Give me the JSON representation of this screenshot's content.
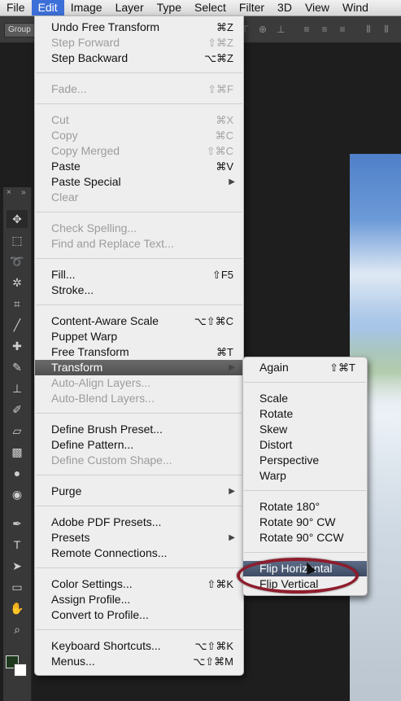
{
  "menubar": {
    "items": [
      "File",
      "Edit",
      "Image",
      "Layer",
      "Type",
      "Select",
      "Filter",
      "3D",
      "View",
      "Wind"
    ],
    "active_index": 1
  },
  "optionsbar": {
    "group_label": "Group"
  },
  "edit_menu": {
    "items": [
      {
        "label": "Undo Free Transform",
        "shortcut": "⌘Z",
        "enabled": true
      },
      {
        "label": "Step Forward",
        "shortcut": "⇧⌘Z",
        "enabled": false
      },
      {
        "label": "Step Backward",
        "shortcut": "⌥⌘Z",
        "enabled": true
      },
      {
        "label": "Fade...",
        "shortcut": "⇧⌘F",
        "enabled": false
      },
      {
        "label": "Cut",
        "shortcut": "⌘X",
        "enabled": false
      },
      {
        "label": "Copy",
        "shortcut": "⌘C",
        "enabled": false
      },
      {
        "label": "Copy Merged",
        "shortcut": "⇧⌘C",
        "enabled": false
      },
      {
        "label": "Paste",
        "shortcut": "⌘V",
        "enabled": true
      },
      {
        "label": "Paste Special",
        "submenu": true,
        "enabled": true
      },
      {
        "label": "Clear",
        "enabled": false
      },
      {
        "label": "Check Spelling...",
        "enabled": false
      },
      {
        "label": "Find and Replace Text...",
        "enabled": false
      },
      {
        "label": "Fill...",
        "shortcut": "⇧F5",
        "enabled": true
      },
      {
        "label": "Stroke...",
        "enabled": true
      },
      {
        "label": "Content-Aware Scale",
        "shortcut": "⌥⇧⌘C",
        "enabled": true
      },
      {
        "label": "Puppet Warp",
        "enabled": true
      },
      {
        "label": "Free Transform",
        "shortcut": "⌘T",
        "enabled": true
      },
      {
        "label": "Transform",
        "submenu": true,
        "enabled": true,
        "highlighted": true
      },
      {
        "label": "Auto-Align Layers...",
        "enabled": false
      },
      {
        "label": "Auto-Blend Layers...",
        "enabled": false
      },
      {
        "label": "Define Brush Preset...",
        "enabled": true
      },
      {
        "label": "Define Pattern...",
        "enabled": true
      },
      {
        "label": "Define Custom Shape...",
        "enabled": false
      },
      {
        "label": "Purge",
        "submenu": true,
        "enabled": true
      },
      {
        "label": "Adobe PDF Presets...",
        "enabled": true
      },
      {
        "label": "Presets",
        "submenu": true,
        "enabled": true
      },
      {
        "label": "Remote Connections...",
        "enabled": true
      },
      {
        "label": "Color Settings...",
        "shortcut": "⇧⌘K",
        "enabled": true
      },
      {
        "label": "Assign Profile...",
        "enabled": true
      },
      {
        "label": "Convert to Profile...",
        "enabled": true
      },
      {
        "label": "Keyboard Shortcuts...",
        "shortcut": "⌥⇧⌘K",
        "enabled": true
      },
      {
        "label": "Menus...",
        "shortcut": "⌥⇧⌘M",
        "enabled": true
      }
    ]
  },
  "transform_submenu": {
    "items": [
      {
        "label": "Again",
        "shortcut": "⇧⌘T"
      },
      {
        "label": "Scale"
      },
      {
        "label": "Rotate"
      },
      {
        "label": "Skew"
      },
      {
        "label": "Distort"
      },
      {
        "label": "Perspective"
      },
      {
        "label": "Warp"
      },
      {
        "label": "Rotate 180°"
      },
      {
        "label": "Rotate 90° CW"
      },
      {
        "label": "Rotate 90° CCW"
      },
      {
        "label": "Flip Horizontal",
        "highlighted": true
      },
      {
        "label": "Flip Vertical"
      }
    ]
  },
  "colors": {
    "menu_bg": "#eeeeee",
    "highlight": "#3d4b64",
    "annotation": "#8e1c2c",
    "menubar_active": "#3d6fd8"
  }
}
